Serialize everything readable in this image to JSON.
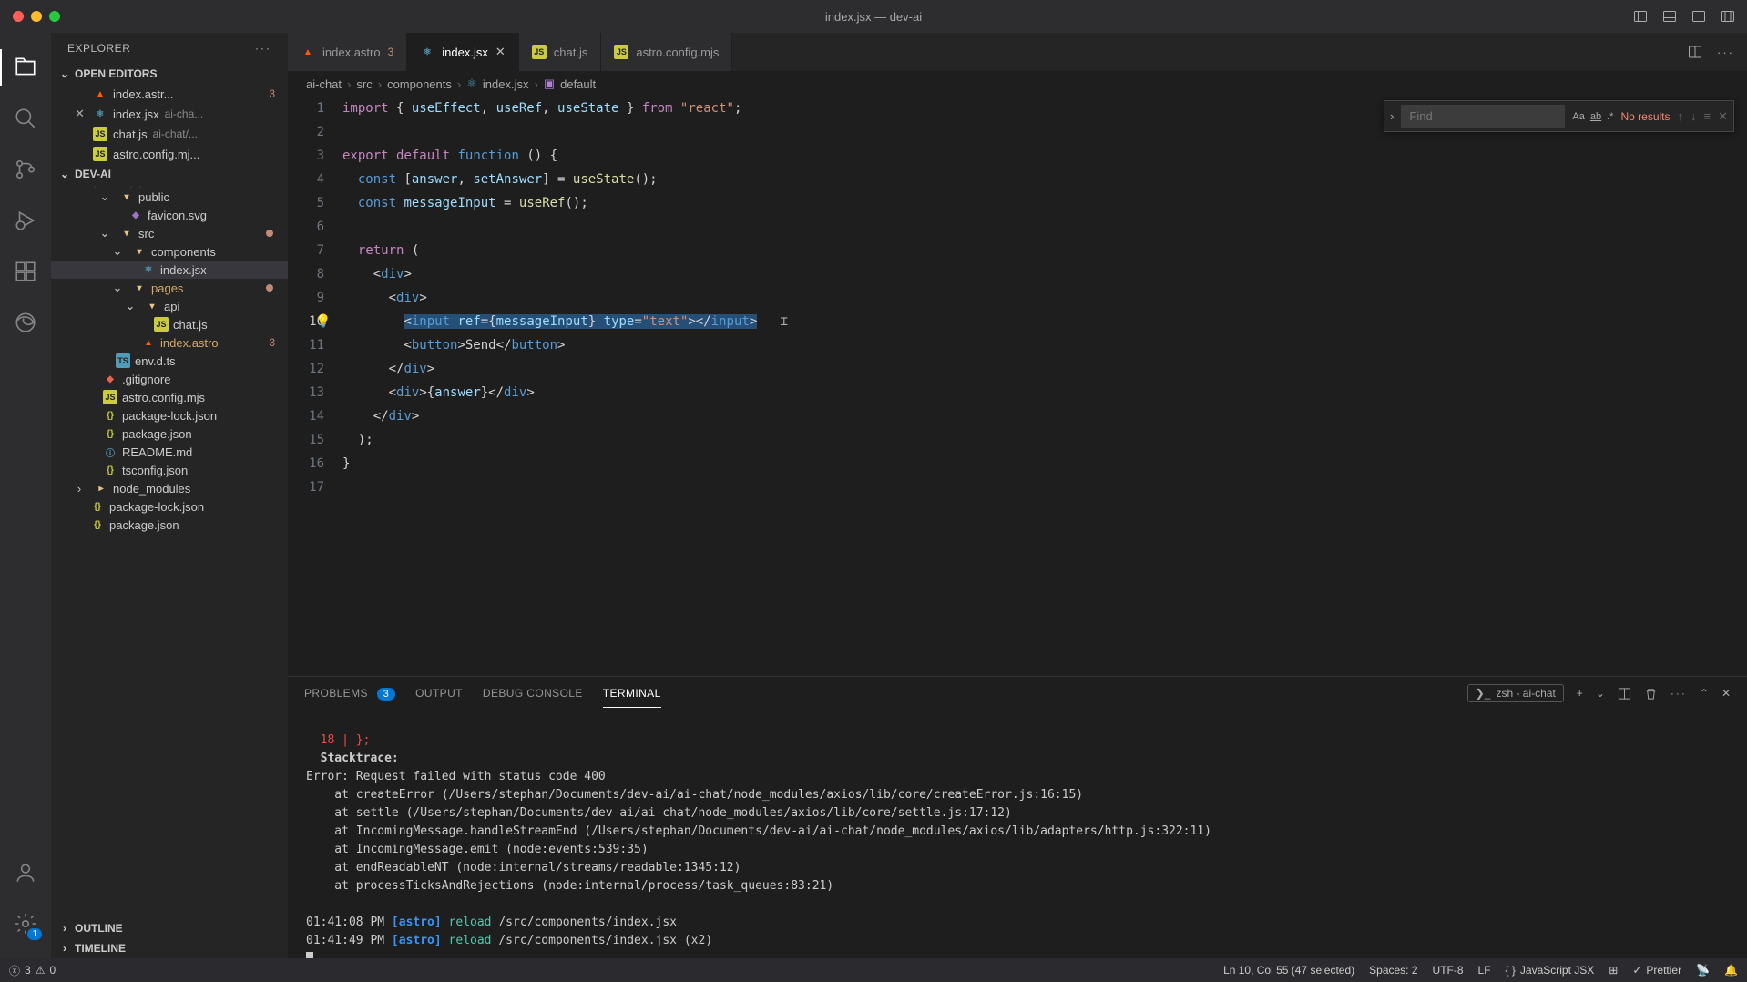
{
  "window": {
    "title": "index.jsx — dev-ai"
  },
  "explorer": {
    "title": "EXPLORER",
    "openEditorsLabel": "OPEN EDITORS",
    "projectName": "DEV-AI",
    "outlineLabel": "OUTLINE",
    "timelineLabel": "TIMELINE",
    "openEditors": [
      {
        "name": "index.astr...",
        "badge": "3",
        "path": ""
      },
      {
        "name": "index.jsx",
        "path": "ai-cha..."
      },
      {
        "name": "chat.js",
        "path": "ai-chat/..."
      },
      {
        "name": "astro.config.mj...",
        "path": ""
      }
    ],
    "tree": [
      {
        "depth": 1,
        "icon": "folder-open",
        "name": "public"
      },
      {
        "depth": 2,
        "icon": "svg",
        "name": "favicon.svg"
      },
      {
        "depth": 1,
        "icon": "folder-open",
        "name": "src",
        "dirty": true
      },
      {
        "depth": 2,
        "icon": "folder-open",
        "name": "components"
      },
      {
        "depth": 3,
        "icon": "jsx",
        "name": "index.jsx",
        "selected": true
      },
      {
        "depth": 2,
        "icon": "folder-open",
        "name": "pages",
        "warn": true,
        "dirty": true
      },
      {
        "depth": 3,
        "icon": "folder-open",
        "name": "api"
      },
      {
        "depth": 4,
        "icon": "js",
        "name": "chat.js"
      },
      {
        "depth": 3,
        "icon": "astro",
        "name": "index.astro",
        "warn": true,
        "badge": "3"
      },
      {
        "depth": 1,
        "icon": "ts",
        "name": "env.d.ts"
      },
      {
        "depth": 0,
        "icon": "git",
        "name": ".gitignore"
      },
      {
        "depth": 0,
        "icon": "js",
        "name": "astro.config.mjs"
      },
      {
        "depth": 0,
        "icon": "json",
        "name": "package-lock.json"
      },
      {
        "depth": 0,
        "icon": "json",
        "name": "package.json"
      },
      {
        "depth": 0,
        "icon": "md",
        "name": "README.md"
      },
      {
        "depth": 0,
        "icon": "json",
        "name": "tsconfig.json"
      },
      {
        "depth": -1,
        "icon": "folder",
        "name": "node_modules"
      },
      {
        "depth": -1,
        "icon": "json",
        "name": "package-lock.json"
      },
      {
        "depth": -1,
        "icon": "json",
        "name": "package.json"
      }
    ]
  },
  "tabs": [
    {
      "name": "index.astro",
      "icon": "astro",
      "badge": "3"
    },
    {
      "name": "index.jsx",
      "icon": "jsx",
      "active": true,
      "close": true
    },
    {
      "name": "chat.js",
      "icon": "js"
    },
    {
      "name": "astro.config.mjs",
      "icon": "js"
    }
  ],
  "breadcrumbs": [
    "ai-chat",
    "src",
    "components",
    "index.jsx",
    "default"
  ],
  "find": {
    "placeholder": "Find",
    "noResults": "No results"
  },
  "code": {
    "lines": 17,
    "activeLine": 10
  },
  "panel": {
    "tabs": {
      "problems": "PROBLEMS",
      "problemsCount": "3",
      "output": "OUTPUT",
      "debug": "DEBUG CONSOLE",
      "terminal": "TERMINAL"
    },
    "termLabel": "zsh - ai-chat"
  },
  "terminal": {
    "l1": "  18 | };",
    "l2": "  Stacktrace:",
    "l3": "Error: Request failed with status code 400",
    "l4": "    at createError (/Users/stephan/Documents/dev-ai/ai-chat/node_modules/axios/lib/core/createError.js:16:15)",
    "l5": "    at settle (/Users/stephan/Documents/dev-ai/ai-chat/node_modules/axios/lib/core/settle.js:17:12)",
    "l6": "    at IncomingMessage.handleStreamEnd (/Users/stephan/Documents/dev-ai/ai-chat/node_modules/axios/lib/adapters/http.js:322:11)",
    "l7": "    at IncomingMessage.emit (node:events:539:35)",
    "l8": "    at endReadableNT (node:internal/streams/readable:1345:12)",
    "l9": "    at processTicksAndRejections (node:internal/process/task_queues:83:21)",
    "l10a": "01:41:08 PM ",
    "l10b": "[astro] ",
    "l10c": "reload ",
    "l10d": "/src/components/index.jsx",
    "l11a": "01:41:49 PM ",
    "l11b": "[astro] ",
    "l11c": "reload ",
    "l11d": "/src/components/index.jsx (x2)"
  },
  "status": {
    "errors": "3",
    "warnings": "0",
    "position": "Ln 10, Col 55 (47 selected)",
    "spaces": "Spaces: 2",
    "encoding": "UTF-8",
    "eol": "LF",
    "lang": "JavaScript JSX",
    "prettier": "Prettier"
  }
}
